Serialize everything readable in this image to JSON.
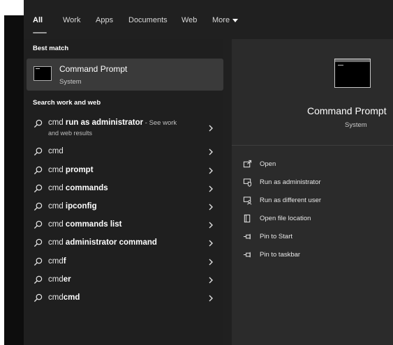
{
  "tabs": [
    {
      "label": "All"
    },
    {
      "label": "Work"
    },
    {
      "label": "Apps"
    },
    {
      "label": "Documents"
    },
    {
      "label": "Web"
    },
    {
      "label": "More"
    }
  ],
  "best_match": {
    "heading": "Best match",
    "title": "Command Prompt",
    "subtitle": "System"
  },
  "search_section": {
    "heading": "Search work and web",
    "results": [
      {
        "prefix": "cmd ",
        "bold": "run as administrator",
        "suffix": " - See work",
        "sub": "and web results"
      },
      {
        "prefix": "cmd",
        "bold": "",
        "suffix": ""
      },
      {
        "prefix": "cmd ",
        "bold": "prompt",
        "suffix": ""
      },
      {
        "prefix": "cmd ",
        "bold": "commands",
        "suffix": ""
      },
      {
        "prefix": "cmd ",
        "bold": "ipconfig",
        "suffix": ""
      },
      {
        "prefix": "cmd ",
        "bold": "commands list",
        "suffix": ""
      },
      {
        "prefix": "cmd ",
        "bold": "administrator command",
        "suffix": ""
      },
      {
        "prefix": "cmd",
        "bold": "f",
        "suffix": ""
      },
      {
        "prefix": "cmd",
        "bold": "er",
        "suffix": ""
      },
      {
        "prefix": "cmd",
        "bold": "cmd",
        "suffix": ""
      }
    ]
  },
  "preview": {
    "title": "Command Prompt",
    "subtitle": "System",
    "actions": [
      {
        "label": "Open",
        "icon": "open-window-icon"
      },
      {
        "label": "Run as administrator",
        "icon": "shield-icon"
      },
      {
        "label": "Run as different user",
        "icon": "user-switch-icon"
      },
      {
        "label": "Open file location",
        "icon": "folder-location-icon"
      },
      {
        "label": "Pin to Start",
        "icon": "pin-icon"
      },
      {
        "label": "Pin to taskbar",
        "icon": "pin-icon"
      }
    ]
  },
  "colors": {
    "panel_bg": "#202020",
    "preview_bg": "#2b2b2b",
    "selected_bg": "#3a3a3a"
  }
}
